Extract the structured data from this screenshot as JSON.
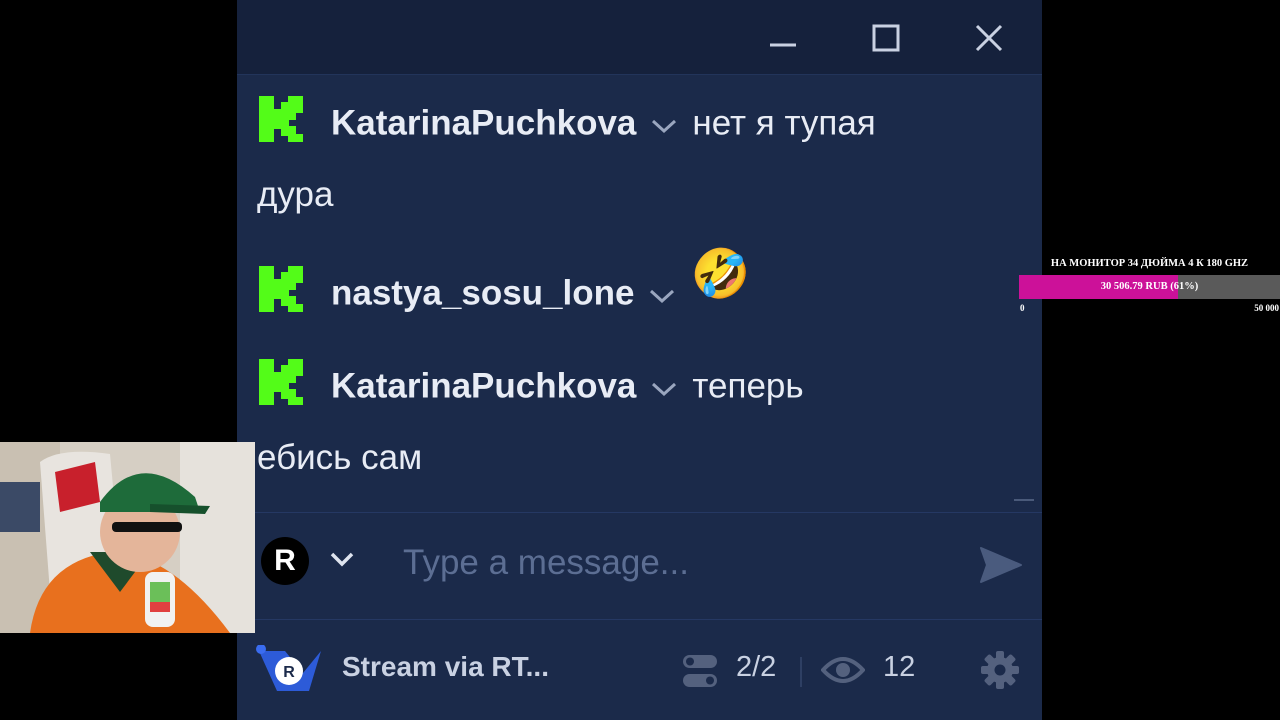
{
  "window": {
    "controls": {
      "minimize": "minimize-icon",
      "maximize": "maximize-icon",
      "close": "close-icon"
    }
  },
  "chat": {
    "messages": [
      {
        "platform_icon": "kick-icon",
        "user": "KatarinaPuchkova",
        "text_line1": "нет я тупая",
        "text_line2": "дура"
      },
      {
        "platform_icon": "kick-icon",
        "user": "nastya_sosu_lone",
        "emoji": "🤣"
      },
      {
        "platform_icon": "kick-icon",
        "user": "KatarinaPuchkova",
        "text_line1": "теперь",
        "text_line2": "ебись сам"
      }
    ],
    "platform_color": "#53fc18"
  },
  "composer": {
    "account_letter": "R",
    "placeholder": "Type a message...",
    "send_icon": "send-icon"
  },
  "footer": {
    "stream_label": "Stream via RT...",
    "channels": "2/2",
    "viewers": "12",
    "settings_icon": "gear-icon"
  },
  "goal": {
    "title": "НА МОНИТОР 34 ДЮЙМА 4 К 180 GHZ",
    "amount": "30 506.79 RUB (61%)",
    "progress": 0.61,
    "min": "0",
    "max": "50 000",
    "fill_color": "#cc1199"
  },
  "colors": {
    "window_bg": "#1b2a4a",
    "titlebar_bg": "#15213c"
  }
}
